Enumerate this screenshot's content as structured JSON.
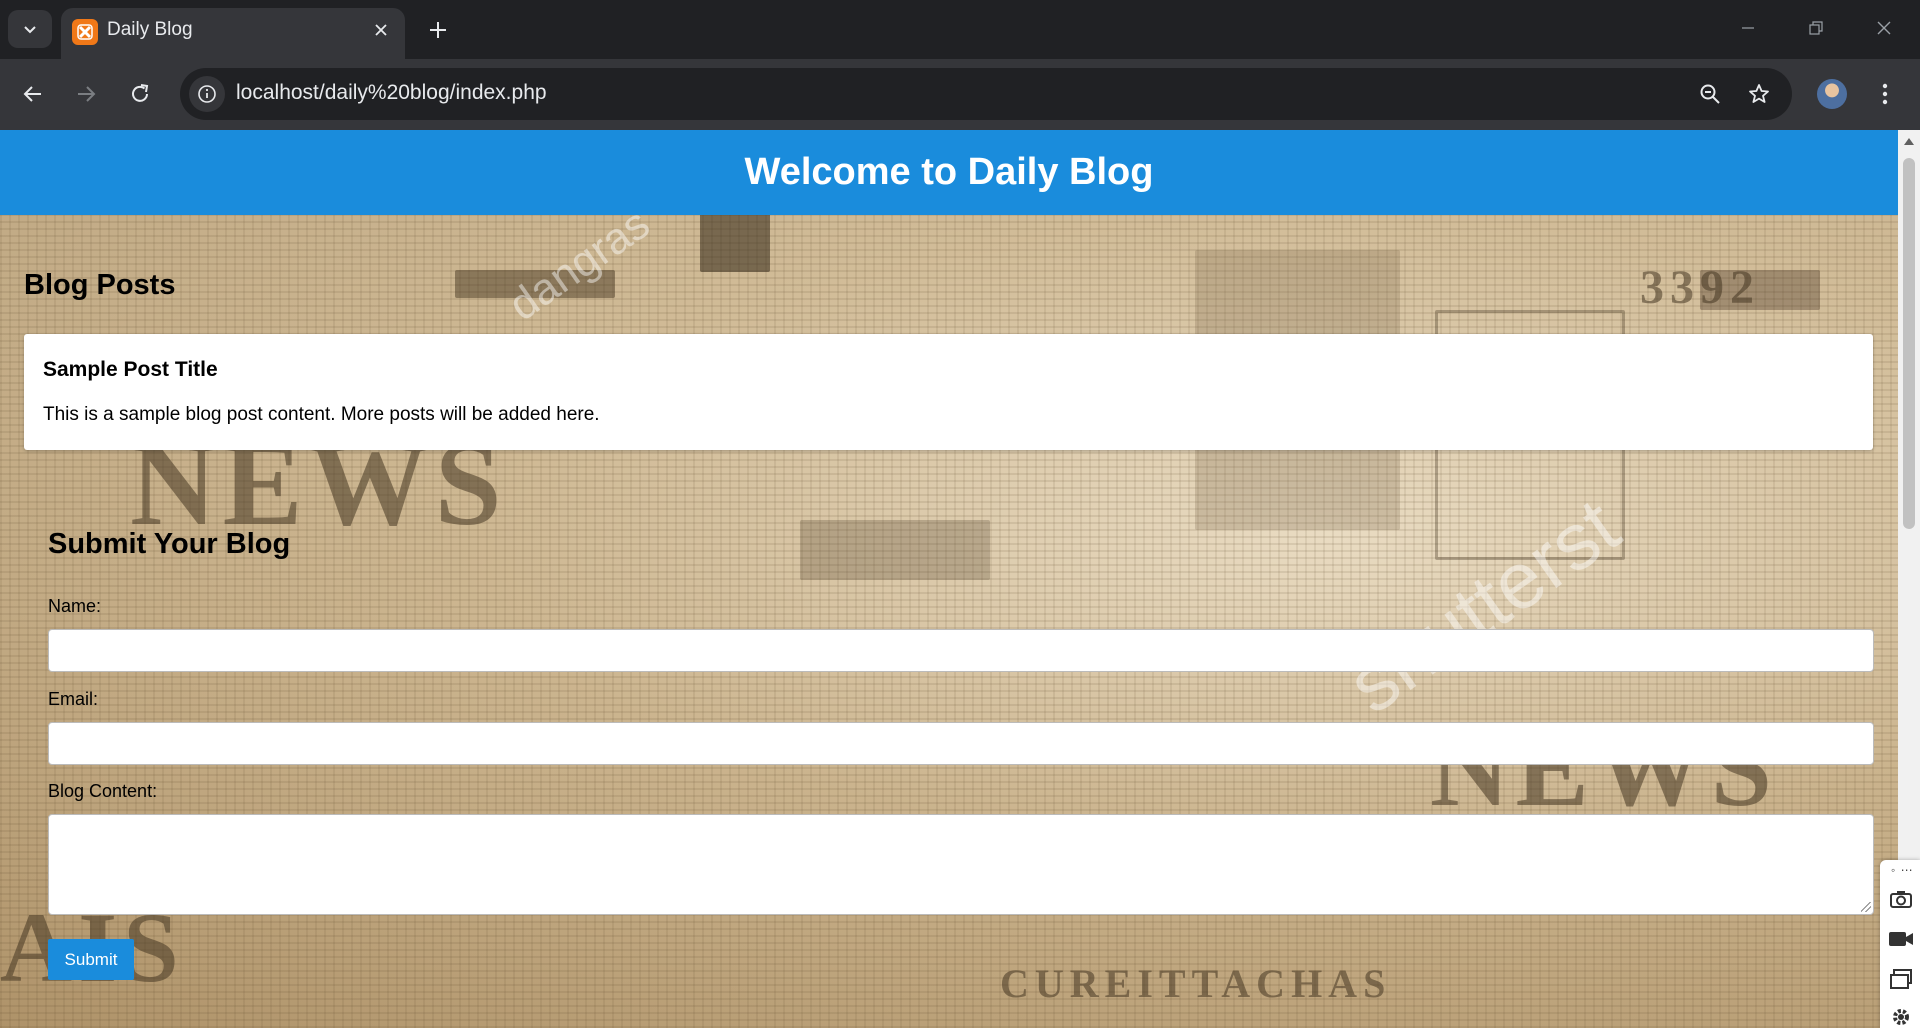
{
  "browser": {
    "tab": {
      "title": "Daily Blog",
      "favicon": "xampp-icon"
    },
    "url": "localhost/daily%20blog/index.php",
    "icons": {
      "tab_search": "chevron-down-icon",
      "tab_close": "close-icon",
      "new_tab": "plus-icon",
      "minimize": "minimize-icon",
      "restore": "restore-icon",
      "close_window": "close-icon",
      "back": "back-arrow-icon",
      "forward": "forward-arrow-icon",
      "reload": "reload-icon",
      "site_info": "info-icon",
      "zoom": "zoom-out-icon",
      "bookmark": "star-icon",
      "menu": "kebab-menu-icon"
    }
  },
  "page": {
    "header_title": "Welcome to Daily Blog",
    "posts_heading": "Blog Posts",
    "posts": [
      {
        "title": "Sample Post Title",
        "content": "This is a sample blog post content. More posts will be added here."
      }
    ],
    "form": {
      "heading": "Submit Your Blog",
      "name_label": "Name:",
      "name_value": "",
      "email_label": "Email:",
      "email_value": "",
      "content_label": "Blog Content:",
      "content_value": "",
      "submit_label": "Submit"
    }
  },
  "capture_toolbar": {
    "dots": "◦ ⋯",
    "icons": [
      "camera-icon",
      "video-icon",
      "windows-icon",
      "settings-icon"
    ]
  },
  "colors": {
    "header_bg": "#1a8cdc",
    "button_bg": "#1a8cdc",
    "chrome_dark": "#202124",
    "chrome_mid": "#35363a"
  }
}
